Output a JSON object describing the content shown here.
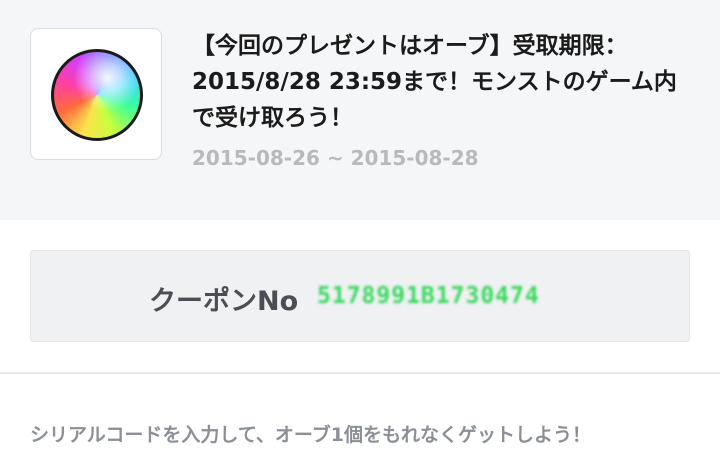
{
  "present": {
    "icon": "orb-icon",
    "title": "【今回のプレゼントはオーブ】受取期限：2015/8/28 23:59まで！モンストのゲーム内で受け取ろう！",
    "date_range": "2015-08-26 ~ 2015-08-28"
  },
  "coupon": {
    "label": "クーポンNo",
    "code": "5178991B1730474"
  },
  "instruction": "シリアルコードを入力して、オーブ1個をもれなくゲットしよう！",
  "colors": {
    "header_bg": "#f5f6f7",
    "title": "#1b1b1b",
    "date": "#b7b9bd",
    "coupon_bg": "#eff1f2",
    "coupon_code": "#39d85e",
    "instruction": "#8b8f96"
  }
}
